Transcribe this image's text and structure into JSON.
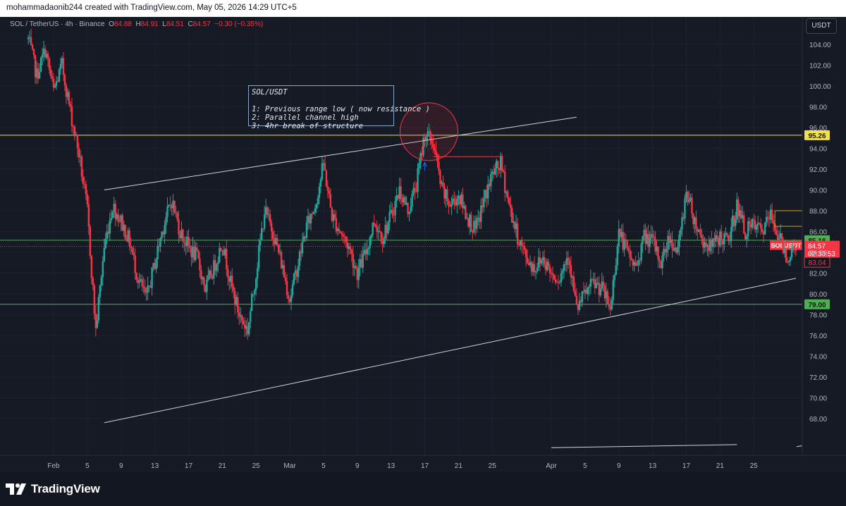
{
  "header": {
    "text": "mohammadaonib244 created with TradingView.com, May 05, 2026 14:29 UTC+5"
  },
  "legend": {
    "symbol": "SOL / TetherUS · 4h · Binance",
    "open_label": "O",
    "open": "84.88",
    "high_label": "H",
    "high": "84.91",
    "low_label": "L",
    "low": "84.51",
    "close_label": "C",
    "close": "84.57",
    "change": "−0.30 (−0.35%)"
  },
  "currency": "USDT",
  "annotation": {
    "text": "SOL/USDT\n\n1: Previous range low ( now resistance )\n2: Parallel channel high\n3: 4hr break of structure"
  },
  "brand": {
    "name": "TradingView"
  },
  "colors": {
    "background": "#161a25",
    "bull": "#26a69a",
    "bear": "#f23645",
    "yellow_level": "#f2e14b",
    "green_level": "#4caf50",
    "channel": "#d1d4dc"
  },
  "chart_data": {
    "type": "candlestick",
    "symbol": "SOLUSDT",
    "interval": "4h",
    "ylim": [
      66,
      106
    ],
    "y_ticks": [
      68,
      70,
      72,
      74,
      76,
      78,
      80,
      82,
      84,
      86,
      88,
      90,
      92,
      94,
      96,
      98,
      100,
      102,
      104
    ],
    "x_tick_labels": [
      "Feb",
      "5",
      "9",
      "13",
      "17",
      "21",
      "25",
      "Mar",
      "5",
      "9",
      "13",
      "17",
      "21",
      "25",
      "Apr",
      "5",
      "9",
      "13",
      "17",
      "21",
      "25"
    ],
    "x_tick_dates": [
      "2026-02-01",
      "2026-02-05",
      "2026-02-09",
      "2026-02-13",
      "2026-02-17",
      "2026-02-21",
      "2026-02-25",
      "2026-03-01",
      "2026-03-05",
      "2026-03-09",
      "2026-03-13",
      "2026-03-17",
      "2026-03-21",
      "2026-03-25",
      "2026-04-01",
      "2026-04-05",
      "2026-04-09",
      "2026-04-13",
      "2026-04-17",
      "2026-04-21",
      "2026-04-25"
    ],
    "x_range": [
      "2026-01-29",
      "2026-04-30"
    ],
    "price_path": [
      [
        "2026-01-29",
        104.5
      ],
      [
        "2026-01-30",
        101
      ],
      [
        "2026-01-31",
        103.5
      ],
      [
        "2026-02-01",
        99.5
      ],
      [
        "2026-02-02",
        102
      ],
      [
        "2026-02-03",
        97.5
      ],
      [
        "2026-02-04",
        93.5
      ],
      [
        "2026-02-05",
        88
      ],
      [
        "2026-02-06",
        76.5
      ],
      [
        "2026-02-07",
        84.5
      ],
      [
        "2026-02-08",
        88.5
      ],
      [
        "2026-02-09",
        87
      ],
      [
        "2026-02-10",
        85
      ],
      [
        "2026-02-11",
        81.5
      ],
      [
        "2026-02-12",
        79.5
      ],
      [
        "2026-02-13",
        83
      ],
      [
        "2026-02-14",
        86.5
      ],
      [
        "2026-02-15",
        89
      ],
      [
        "2026-02-16",
        86
      ],
      [
        "2026-02-17",
        84.5
      ],
      [
        "2026-02-18",
        83.5
      ],
      [
        "2026-02-19",
        80.5
      ],
      [
        "2026-02-20",
        82.5
      ],
      [
        "2026-02-21",
        85
      ],
      [
        "2026-02-22",
        81
      ],
      [
        "2026-02-23",
        78
      ],
      [
        "2026-02-24",
        76.5
      ],
      [
        "2026-02-25",
        82
      ],
      [
        "2026-02-26",
        88
      ],
      [
        "2026-02-27",
        86
      ],
      [
        "2026-02-28",
        83
      ],
      [
        "2026-03-01",
        79.5
      ],
      [
        "2026-03-02",
        83
      ],
      [
        "2026-03-03",
        86.5
      ],
      [
        "2026-03-04",
        88.5
      ],
      [
        "2026-03-05",
        92.5
      ],
      [
        "2026-03-06",
        87.5
      ],
      [
        "2026-03-07",
        86
      ],
      [
        "2026-03-08",
        84.5
      ],
      [
        "2026-03-09",
        82
      ],
      [
        "2026-03-10",
        84
      ],
      [
        "2026-03-11",
        87
      ],
      [
        "2026-03-12",
        85.5
      ],
      [
        "2026-03-13",
        87.5
      ],
      [
        "2026-03-14",
        90
      ],
      [
        "2026-03-15",
        88
      ],
      [
        "2026-03-16",
        90.5
      ],
      [
        "2026-03-17",
        95.5
      ],
      [
        "2026-03-18",
        94.5
      ],
      [
        "2026-03-19",
        90
      ],
      [
        "2026-03-20",
        88.5
      ],
      [
        "2026-03-21",
        89.5
      ],
      [
        "2026-03-22",
        87.5
      ],
      [
        "2026-03-23",
        86
      ],
      [
        "2026-03-24",
        89
      ],
      [
        "2026-03-25",
        91.5
      ],
      [
        "2026-03-26",
        92.5
      ],
      [
        "2026-03-27",
        88.5
      ],
      [
        "2026-03-28",
        85.5
      ],
      [
        "2026-03-29",
        83.5
      ],
      [
        "2026-03-30",
        82.5
      ],
      [
        "2026-03-31",
        83.5
      ],
      [
        "2026-04-01",
        82
      ],
      [
        "2026-04-02",
        81.5
      ],
      [
        "2026-04-03",
        84
      ],
      [
        "2026-04-04",
        78.5
      ],
      [
        "2026-04-05",
        80
      ],
      [
        "2026-04-06",
        81
      ],
      [
        "2026-04-07",
        80.5
      ],
      [
        "2026-04-08",
        78.5
      ],
      [
        "2026-04-09",
        86
      ],
      [
        "2026-04-10",
        84
      ],
      [
        "2026-04-11",
        82.5
      ],
      [
        "2026-04-12",
        85.5
      ],
      [
        "2026-04-13",
        85
      ],
      [
        "2026-04-14",
        83
      ],
      [
        "2026-04-15",
        85.5
      ],
      [
        "2026-04-16",
        84
      ],
      [
        "2026-04-17",
        90
      ],
      [
        "2026-04-18",
        87
      ],
      [
        "2026-04-19",
        85
      ],
      [
        "2026-04-20",
        84.5
      ],
      [
        "2026-04-21",
        85.5
      ],
      [
        "2026-04-22",
        85
      ],
      [
        "2026-04-23",
        88.5
      ],
      [
        "2026-04-24",
        86
      ],
      [
        "2026-04-25",
        86.5
      ],
      [
        "2026-04-26",
        86
      ],
      [
        "2026-04-27",
        87.5
      ],
      [
        "2026-04-28",
        85.5
      ],
      [
        "2026-04-29",
        83.5
      ],
      [
        "2026-04-30",
        84.57
      ]
    ],
    "horizontal_levels": [
      {
        "price": 95.26,
        "label": "95.26",
        "color": "#f2e14b"
      },
      {
        "price": 85.16,
        "label": "85.16",
        "color": "#4caf50"
      },
      {
        "price": 79.0,
        "label": "79.00",
        "color": "#4caf50"
      }
    ],
    "price_labels": [
      {
        "price": 84.57,
        "label": "84.57",
        "name": "SOLUSDT",
        "countdown": "02:30:53"
      },
      {
        "price": 83.04,
        "label": "83.04"
      }
    ],
    "channel_lines": [
      {
        "from": [
          "2026-02-07",
          90.0
        ],
        "to": [
          "2026-04-04",
          97.0
        ]
      },
      {
        "from": [
          "2026-02-07",
          67.6
        ],
        "to": [
          "2026-04-30",
          81.5
        ]
      },
      {
        "from": [
          "2026-04-01",
          65.2
        ],
        "to": [
          "2026-04-23",
          65.5
        ]
      }
    ],
    "break_of_structure": {
      "from": "2026-03-18",
      "to": "2026-03-26",
      "price": 93.2
    },
    "circle_marker": {
      "date": "2026-03-18",
      "price": 95.6
    }
  }
}
